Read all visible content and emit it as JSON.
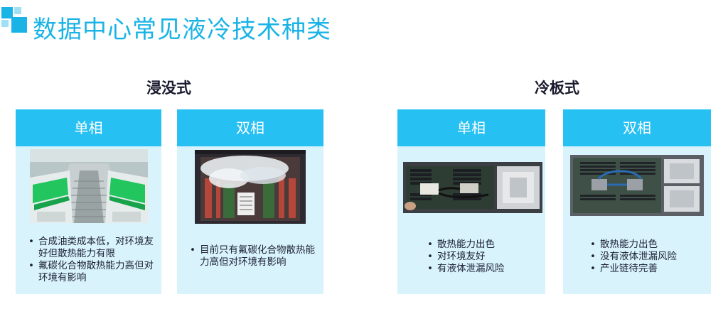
{
  "title": "数据中心常见液冷技术种类",
  "colors": {
    "accent": "#27c0f3",
    "card_bg": "#d8f3fc",
    "title": "#1ab3e6"
  },
  "groups": [
    {
      "title": "浸没式",
      "cards": [
        {
          "header": "单相",
          "image": "immersion-tanks-photo",
          "bullets": [
            "合成油类成本低，对环境友好但散热能力有限",
            "氟碳化合物散热能力高但对环境有影响"
          ]
        },
        {
          "header": "双相",
          "image": "two-phase-immersion-photo",
          "bullets": [
            "目前只有氟碳化合物散热能力高但对环境有影响"
          ]
        }
      ]
    },
    {
      "title": "冷板式",
      "cards": [
        {
          "header": "单相",
          "image": "cold-plate-server-photo",
          "bullets": [
            "散热能力出色",
            "对环境友好",
            "有液体泄漏风险"
          ]
        },
        {
          "header": "双相",
          "image": "two-phase-cold-plate-photo",
          "bullets": [
            "散热能力出色",
            "没有液体泄漏风险",
            "产业链待完善"
          ]
        }
      ]
    }
  ]
}
